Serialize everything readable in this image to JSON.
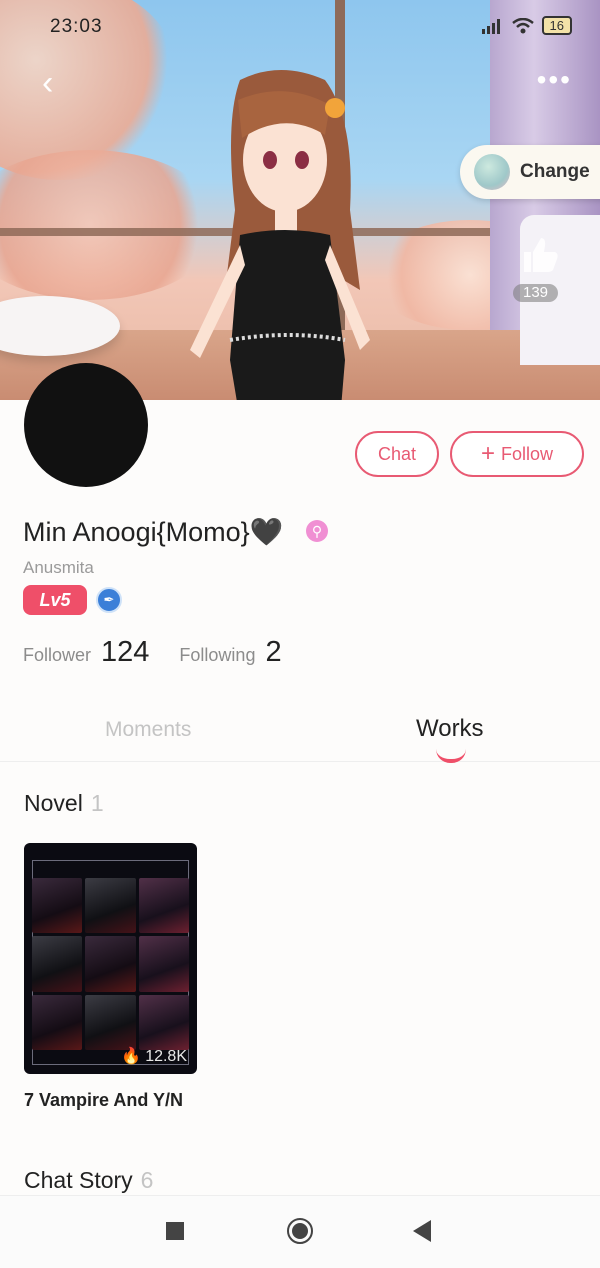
{
  "status_bar": {
    "time": "23:03",
    "battery": "16"
  },
  "header": {
    "change_label": "Change",
    "like_count": "139"
  },
  "profile": {
    "display_name": "Min Anoogi{Momo}🖤",
    "gender_symbol": "⚲",
    "username": "Anusmita",
    "level": "Lv5",
    "chat_label": "Chat",
    "follow_label": "Follow",
    "follower_label": "Follower",
    "follower_count": "124",
    "following_label": "Following",
    "following_count": "2"
  },
  "tabs": {
    "moments": "Moments",
    "works": "Works"
  },
  "sections": {
    "novel": {
      "title": "Novel",
      "count": "1"
    },
    "chat_story": {
      "title": "Chat Story",
      "count": "6"
    }
  },
  "novel_item": {
    "title": "7 Vampire And Y/N",
    "hot_count": "12.8K"
  },
  "icons": [
    "back-icon",
    "more-icon",
    "like-icon",
    "plus-icon",
    "flame-icon",
    "signal-icon",
    "wifi-icon",
    "battery-icon"
  ],
  "colors": {
    "accent": "#ef4f69",
    "muted": "#9a9a9a"
  }
}
